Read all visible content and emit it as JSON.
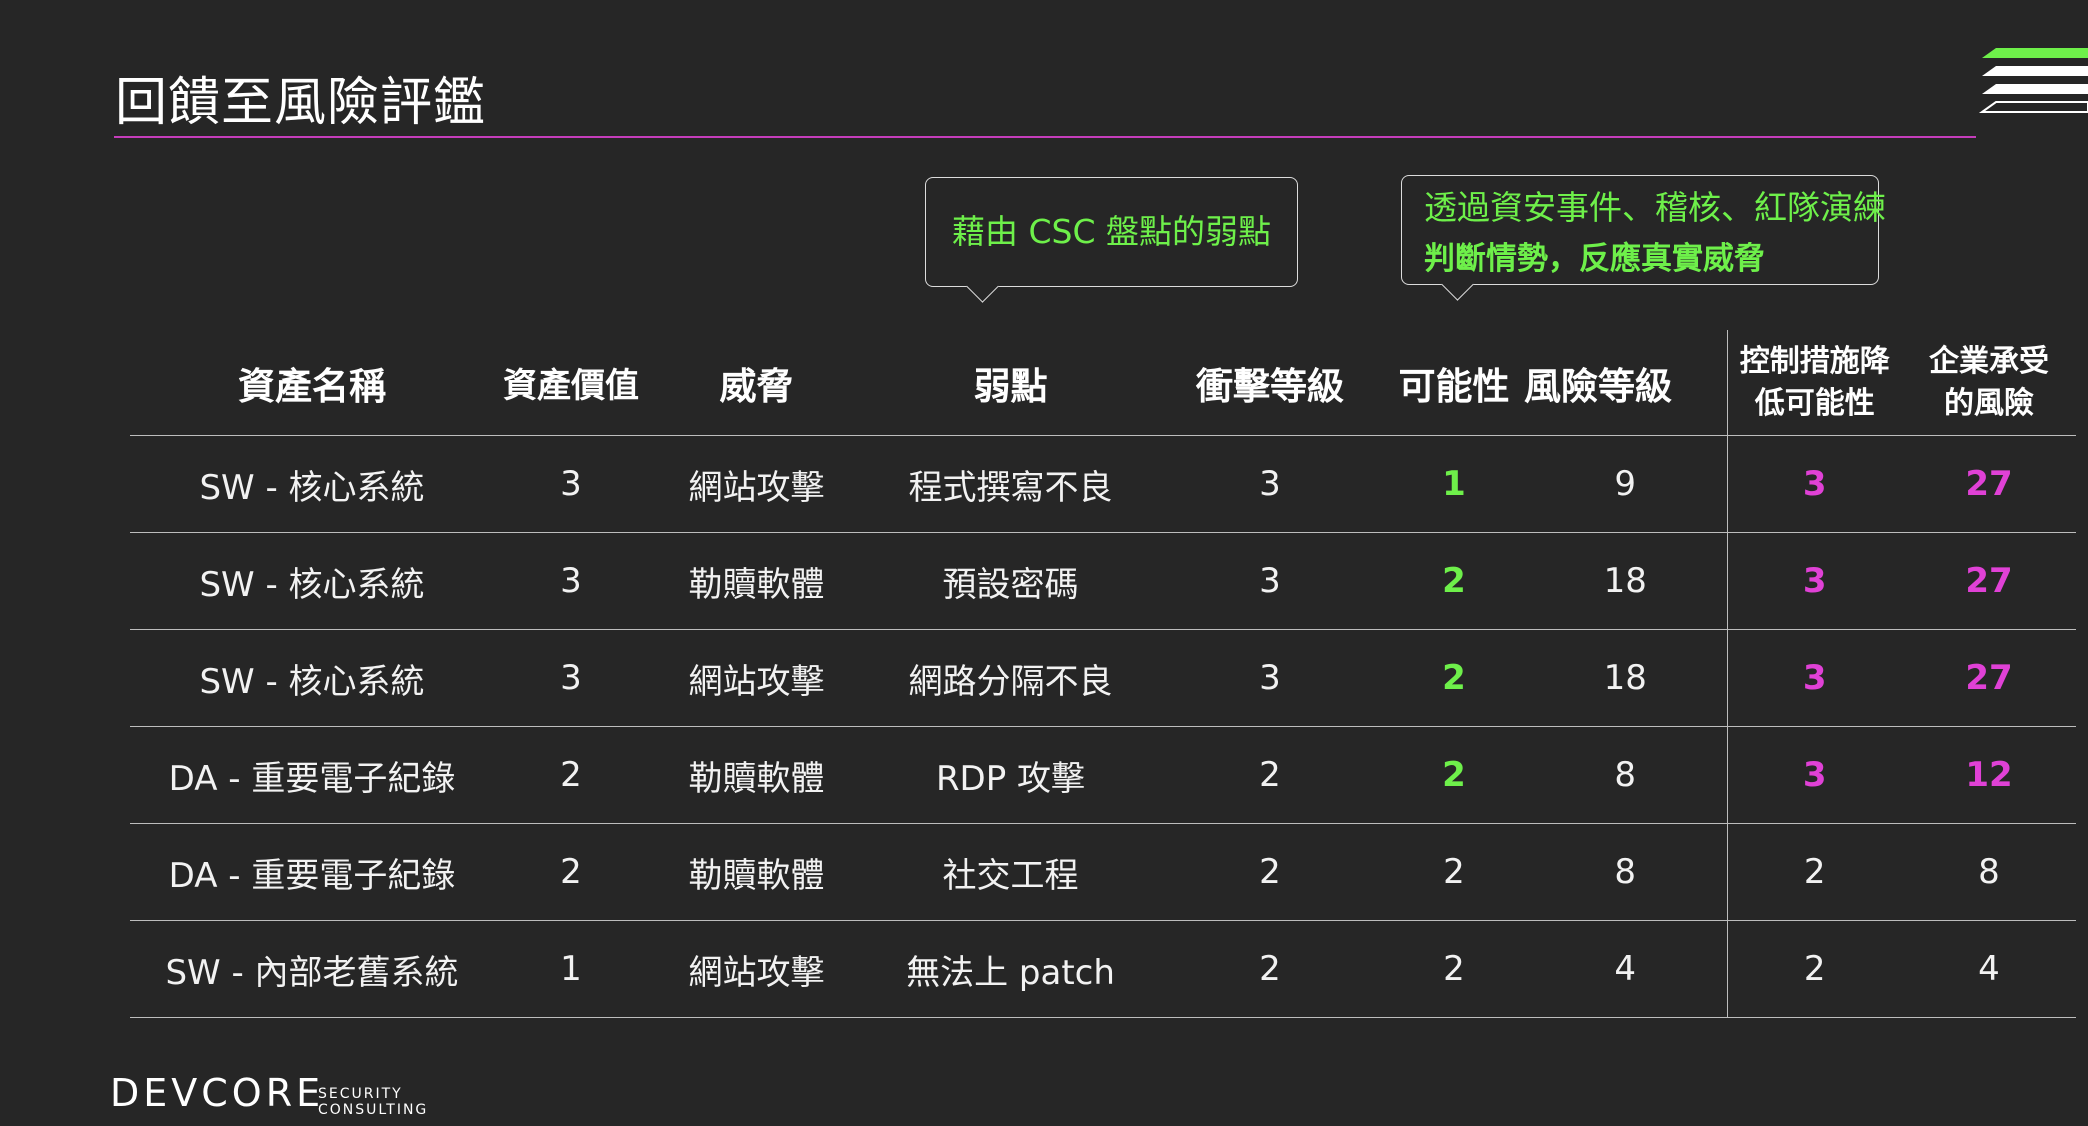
{
  "title": "回饋至風險評鑑",
  "callouts": {
    "csc": "藉由 CSC 盤點的弱點",
    "audit_line1": "透過資安事件、稽核、紅隊演練",
    "audit_line2": "判斷情勢，反應真實威脅"
  },
  "table": {
    "headers": {
      "asset_name": "資產名稱",
      "asset_value": "資產價值",
      "threat": "威脅",
      "vulnerability": "弱點",
      "impact": "衝擊等級",
      "likelihood": "可能性",
      "risk_level": "風險等級",
      "control_line1": "控制措施降",
      "control_line2": "低可能性",
      "residual_line1": "企業承受",
      "residual_line2": "的風險"
    },
    "rows": [
      {
        "asset": "SW - 核心系統",
        "value": "3",
        "threat": "網站攻擊",
        "vuln": "程式撰寫不良",
        "impact": "3",
        "likelihood": "1",
        "risk": "9",
        "control": "3",
        "residual": "27"
      },
      {
        "asset": "SW - 核心系統",
        "value": "3",
        "threat": "勒贖軟體",
        "vuln": "預設密碼",
        "impact": "3",
        "likelihood": "2",
        "risk": "18",
        "control": "3",
        "residual": "27"
      },
      {
        "asset": "SW - 核心系統",
        "value": "3",
        "threat": "網站攻擊",
        "vuln": "網路分隔不良",
        "impact": "3",
        "likelihood": "2",
        "risk": "18",
        "control": "3",
        "residual": "27"
      },
      {
        "asset": "DA - 重要電子紀錄",
        "value": "2",
        "threat": "勒贖軟體",
        "vuln": "RDP 攻擊",
        "impact": "2",
        "likelihood": "2",
        "risk": "8",
        "control": "3",
        "residual": "12"
      },
      {
        "asset": "DA - 重要電子紀錄",
        "value": "2",
        "threat": "勒贖軟體",
        "vuln": "社交工程",
        "impact": "2",
        "likelihood": "2",
        "risk": "8",
        "control": "2",
        "residual": "8"
      },
      {
        "asset": "SW - 內部老舊系統",
        "value": "1",
        "threat": "網站攻擊",
        "vuln": "無法上 patch",
        "impact": "2",
        "likelihood": "2",
        "risk": "4",
        "control": "2",
        "residual": "4"
      }
    ]
  },
  "brand": {
    "name": "DEVCORE",
    "sub_line1": "SECURITY",
    "sub_line2": "CONSULTING"
  },
  "colors": {
    "background": "#262626",
    "accent_rule": "#c53dbb",
    "highlight_green": "#6ef04a",
    "highlight_pink": "#e041d6"
  }
}
